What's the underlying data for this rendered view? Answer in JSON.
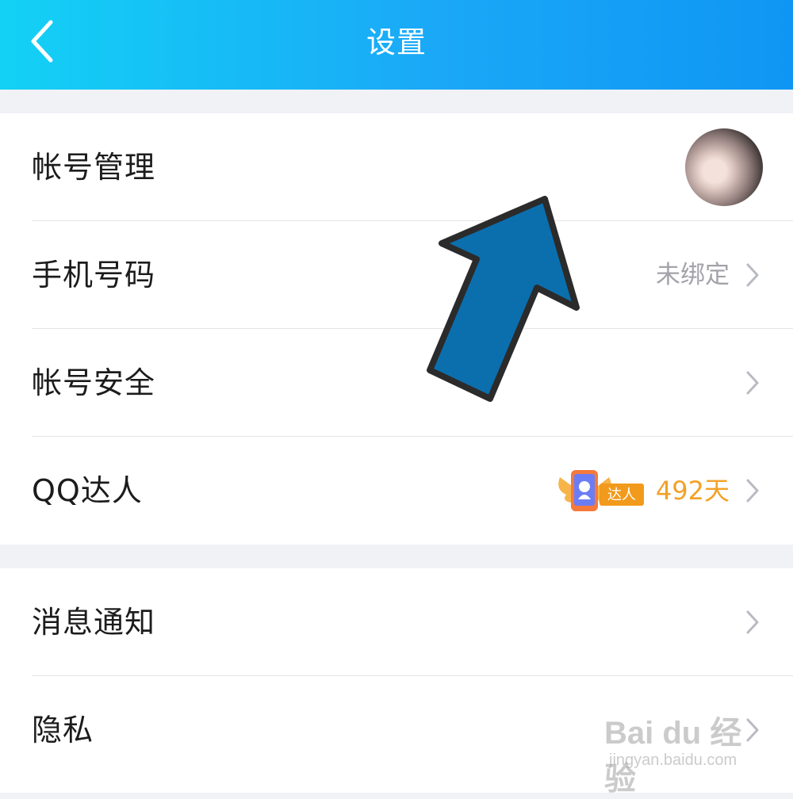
{
  "header": {
    "title": "设置",
    "back_icon": "chevron-left-icon"
  },
  "account_group": {
    "account_manage": {
      "label": "帐号管理"
    },
    "phone": {
      "label": "手机号码",
      "value": "未绑定"
    },
    "security": {
      "label": "帐号安全"
    },
    "qq_expert": {
      "label": "QQ达人",
      "badge_text": "达人",
      "days": "492天"
    }
  },
  "general_group": {
    "notifications": {
      "label": "消息通知"
    },
    "privacy": {
      "label": "隐私"
    }
  },
  "watermark": {
    "logo": "Bai du 经验",
    "url": "jingyan.baidu.com"
  },
  "colors": {
    "header_start": "#13d1f5",
    "header_end": "#0f96f4",
    "arrow_fill": "#0b6fae",
    "days_text": "#f2a128"
  }
}
